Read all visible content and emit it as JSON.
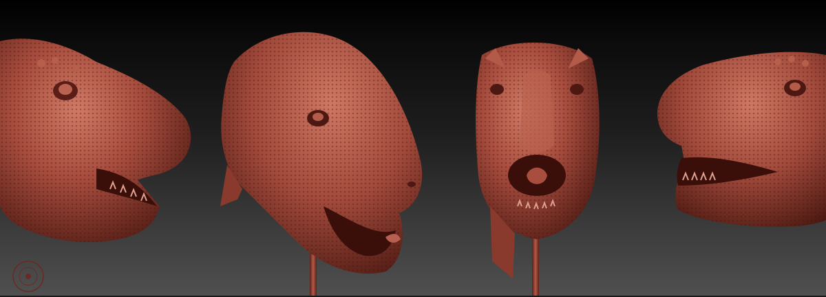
{
  "scene": {
    "background_top": "#000000",
    "background_bottom": "#505050",
    "material_base": "#a34a3c",
    "material_light": "#c9705e",
    "material_dark": "#5a1f17"
  },
  "views": [
    {
      "name": "left-profile",
      "icon": "trex-head-sculpt"
    },
    {
      "name": "three-quarter",
      "icon": "trex-head-sculpt"
    },
    {
      "name": "front",
      "icon": "trex-head-sculpt"
    },
    {
      "name": "right-profile",
      "icon": "trex-head-sculpt"
    }
  ],
  "widget": {
    "icon": "orientation-gizmo-icon",
    "color": "#6a2a22"
  }
}
